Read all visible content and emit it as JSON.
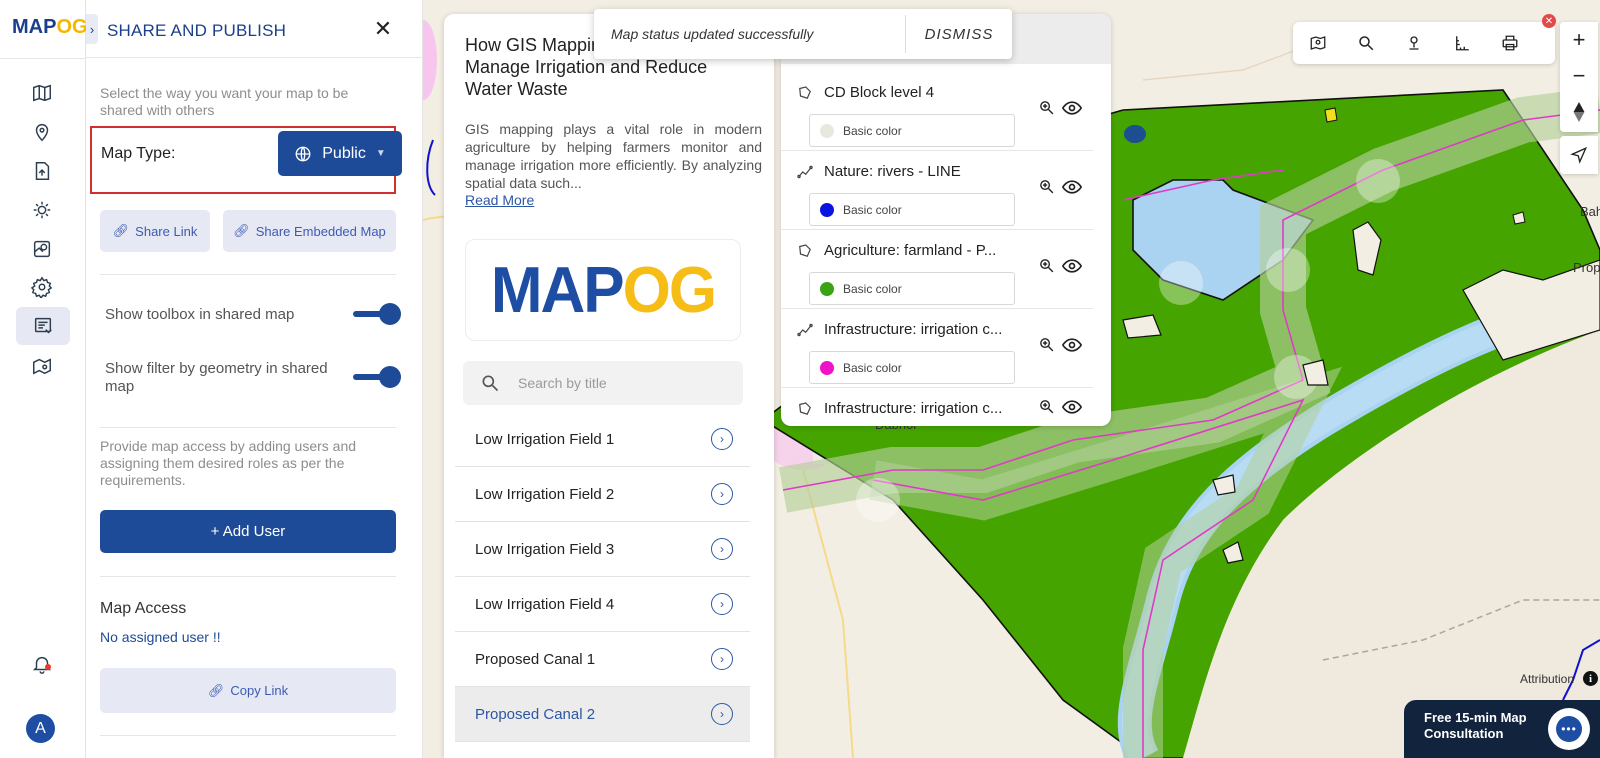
{
  "app": {
    "logo_main": "MAP",
    "logo_accent": "OG",
    "avatar_letter": "A"
  },
  "share_panel": {
    "title": "SHARE AND PUBLISH",
    "intro": "Select the way you want your map to be shared with others",
    "map_type_label": "Map Type:",
    "map_type_value": "Public",
    "share_link": "Share Link",
    "share_embedded": "Share Embedded Map",
    "toggle_toolbox": "Show toolbox in shared map",
    "toggle_toolbox_on": true,
    "toggle_filter": "Show filter by geometry in shared map",
    "toggle_filter_on": true,
    "access_intro": "Provide map access by adding users and assigning them desired roles as per the requirements.",
    "add_user": "+ Add User",
    "access_title": "Map Access",
    "no_user": "No assigned user !!",
    "copy_link": "Copy Link"
  },
  "story": {
    "title": "How GIS Mapping Helps Farmers Manage Irrigation and Reduce Water Waste",
    "description": "GIS mapping plays a vital role in modern agriculture by helping farmers monitor and manage irrigation more efficiently. By analyzing spatial data such...",
    "read_more": "Read More",
    "logo_main": "MAP",
    "logo_accent": "OG",
    "search_placeholder": "Search by title",
    "items": [
      {
        "label": "Low Irrigation Field 1"
      },
      {
        "label": "Low Irrigation Field 2"
      },
      {
        "label": "Low Irrigation Field 3"
      },
      {
        "label": "Low Irrigation Field 4"
      },
      {
        "label": "Proposed Canal 1"
      },
      {
        "label": "Proposed Canal 2"
      }
    ],
    "selected_item": "Proposed Canal 2"
  },
  "layers": {
    "items": [
      {
        "name": "CD Block level 4",
        "style": "Basic color",
        "color": "#e8e8de",
        "icon": "polygon-icon"
      },
      {
        "name": "Nature: rivers - LINE",
        "style": "Basic color",
        "color": "#0a14e0",
        "icon": "line-icon"
      },
      {
        "name": "Agriculture: farmland - P...",
        "style": "Basic color",
        "color": "#3aa312",
        "icon": "polygon-icon"
      },
      {
        "name": "Infrastructure: irrigation c...",
        "style": "Basic color",
        "color": "#f012c8",
        "icon": "line-icon"
      },
      {
        "name": "Infrastructure: irrigation c...",
        "style": "",
        "color": "",
        "icon": "polygon-icon"
      }
    ]
  },
  "toast": {
    "message": "Map status updated successfully",
    "action": "DISMISS"
  },
  "map": {
    "place_label": "Dabhoi",
    "edge_label_1": "Bah",
    "edge_label_2": "Prop",
    "attribution": "Attribution",
    "colors": {
      "farmland": "#45a400",
      "water": "#a9d3f0",
      "canal": "#e03ac8",
      "background": "#f4efe4"
    }
  },
  "consultation": {
    "text": "Free 15-min Map Consultation"
  }
}
